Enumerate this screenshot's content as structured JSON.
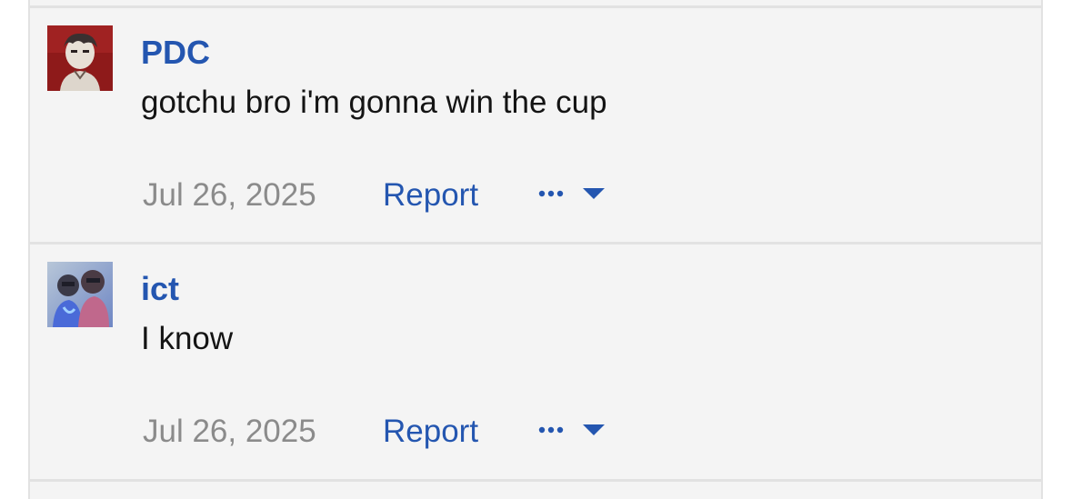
{
  "posts": [
    {
      "username": "PDC",
      "message": "gotchu bro i'm gonna win the cup",
      "date": "Jul 26, 2025",
      "report_label": "Report",
      "more_icon": "ellipsis-icon",
      "dropdown_icon": "caret-down-icon"
    },
    {
      "username": "ict",
      "message": "I know",
      "date": "Jul 26, 2025",
      "report_label": "Report",
      "more_icon": "ellipsis-icon",
      "dropdown_icon": "caret-down-icon"
    }
  ],
  "colors": {
    "link": "#2456b0",
    "muted": "#8b8b8b",
    "text": "#141414",
    "background": "#f4f4f4",
    "divider": "#e2e2e2"
  }
}
